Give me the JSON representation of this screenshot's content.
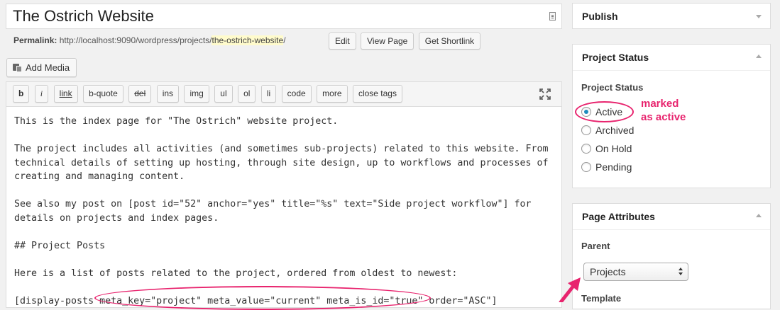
{
  "post": {
    "title": "The Ostrich Website",
    "permalink_label": "Permalink:",
    "permalink_base": "http://localhost:9090/wordpress/projects/",
    "permalink_slug": "the-ostrich-website",
    "permalink_tail": "/",
    "buttons": {
      "edit": "Edit",
      "view_page": "View Page",
      "get_shortlink": "Get Shortlink"
    }
  },
  "media": {
    "add_media_label": "Add Media"
  },
  "toolbar": {
    "b": "b",
    "i": "i",
    "link": "link",
    "bquote": "b-quote",
    "del": "del",
    "ins": "ins",
    "img": "img",
    "ul": "ul",
    "ol": "ol",
    "li": "li",
    "code": "code",
    "more": "more",
    "close_tags": "close tags"
  },
  "content": {
    "text": "This is the index page for \"The Ostrich\" website project.\n\nThe project includes all activities (and sometimes sub-projects) related to this website. From technical details of setting up hosting, through site design, up to workflows and processes of creating and managing content.\n\nSee also my post on [post id=\"52\" anchor=\"yes\" title=\"%s\" text=\"Side project workflow\"] for details on projects and index pages.\n\n## Project Posts\n\nHere is a list of posts related to the project, ordered from oldest to newest:\n\n[display-posts meta_key=\"project\" meta_value=\"current\" meta_is_id=\"true\" order=\"ASC\"]"
  },
  "sidebar": {
    "publish": {
      "title": "Publish"
    },
    "project_status": {
      "title": "Project Status",
      "field_label": "Project Status",
      "options": [
        {
          "label": "Active",
          "checked": true
        },
        {
          "label": "Archived",
          "checked": false
        },
        {
          "label": "On Hold",
          "checked": false
        },
        {
          "label": "Pending",
          "checked": false
        }
      ]
    },
    "page_attributes": {
      "title": "Page Attributes",
      "parent_label": "Parent",
      "parent_value": "Projects",
      "template_label": "Template"
    }
  },
  "annotations": {
    "note_line1": "marked",
    "note_line2": "as active",
    "accent_color": "#e8246e"
  },
  "colors": {
    "radio_checked": "#1e8cbe",
    "slug_highlight": "#fffbcc"
  }
}
